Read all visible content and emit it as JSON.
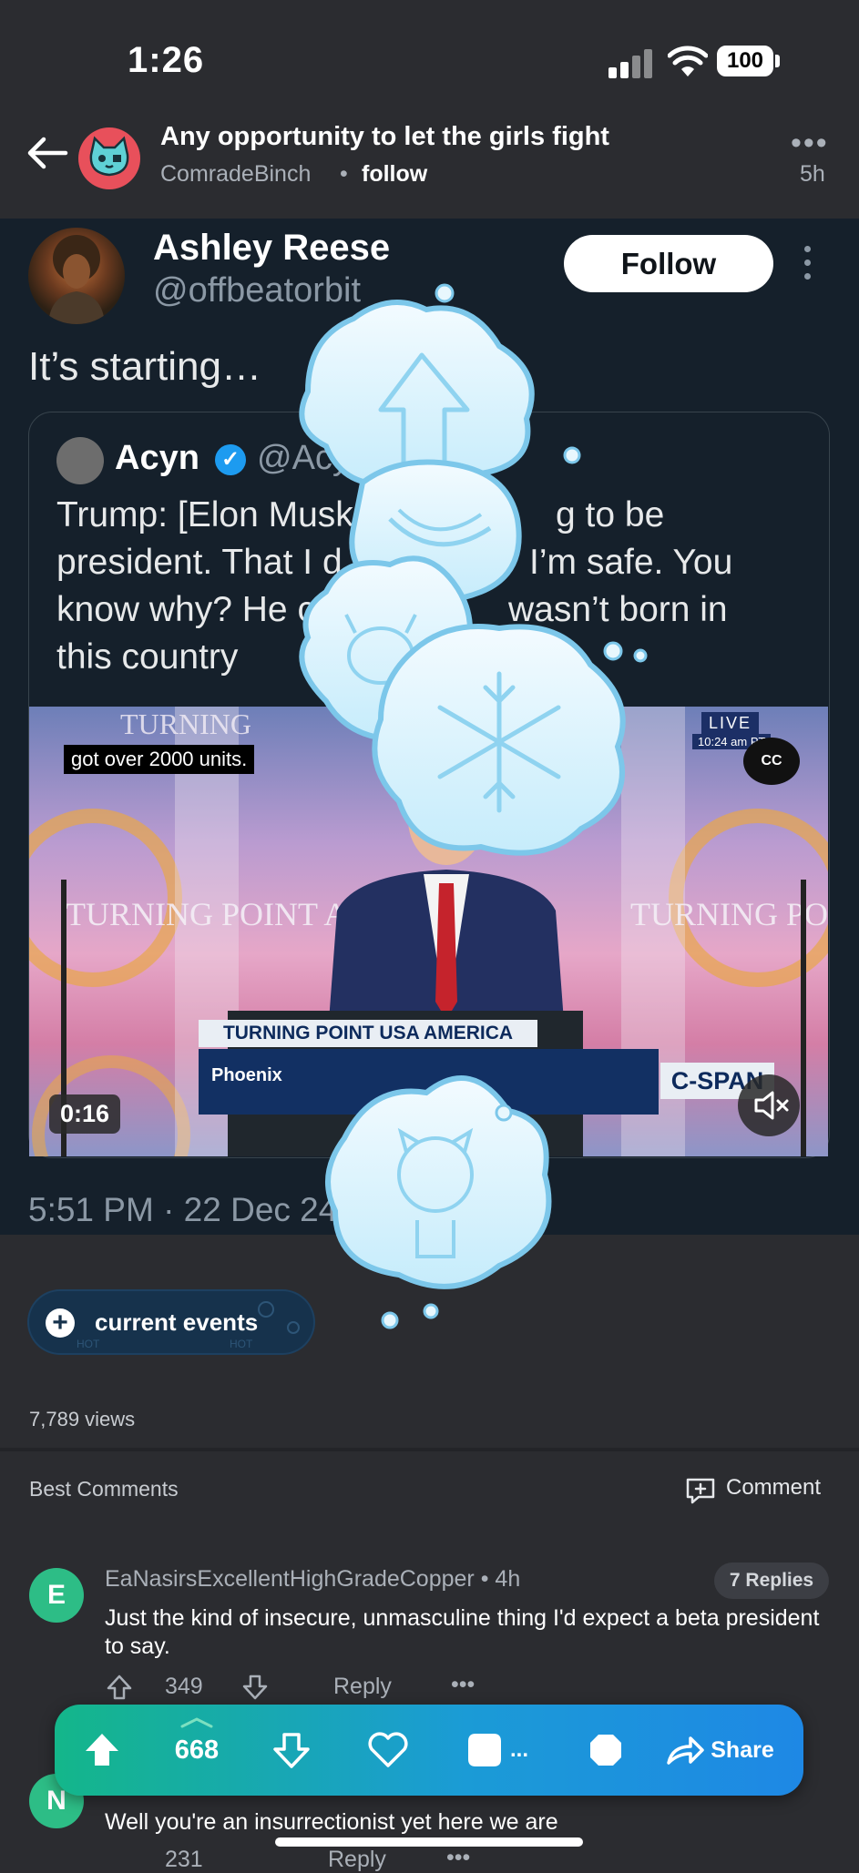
{
  "status_bar": {
    "time": "1:26",
    "battery": "100"
  },
  "post_header": {
    "title": "Any opportunity to let the girls fight",
    "author": "ComradeBinch",
    "separator": "•",
    "follow_label": "follow",
    "more": "•••",
    "age": "5h"
  },
  "tweet": {
    "name": "Ashley Reese",
    "handle": "@offbeatorbit",
    "follow_label": "Follow",
    "text": "It’s starting…",
    "quote": {
      "name": "Acyn",
      "handle": "@Acy",
      "lines": [
        "Trump: [Elon Musk",
        "g to be",
        "president. That I d",
        "I’m safe. You",
        "know why? He ca",
        "wasn’t born in",
        "this country"
      ]
    },
    "video": {
      "caption": "got over 2000 units.",
      "live_badge": "LIVE",
      "live_time": "10:24 am PT",
      "cc": "CC",
      "banner_top": "TURNING POINT USA AMERICA FEST",
      "banner_bottom": "Phoenix",
      "network": "C-SPAN",
      "duration": "0:16",
      "backdrop_text_left": "TURNING POINT ACTION",
      "backdrop_text_right": "TURNING POINT ACTIO",
      "backdrop_text_top": "TURNING"
    },
    "timestamp": "5:51 PM · 22 Dec 24"
  },
  "tag": {
    "label": "current events",
    "pattern_text": "HOT"
  },
  "views": "7,789 views",
  "comments_header": {
    "title": "Best Comments",
    "comment_button": "Comment"
  },
  "comments": [
    {
      "avatar_letter": "E",
      "author": "EaNasirsExcellentHighGradeCopper",
      "sep": "•",
      "age": "4h",
      "replies": "7 Replies",
      "text": "Just the kind of insecure, unmasculine thing I'd expect a beta president to say.",
      "score": "349",
      "reply_label": "Reply",
      "more": "•••"
    },
    {
      "avatar_letter": "N",
      "text": "Well you're an insurrectionist yet here we are",
      "score": "231",
      "reply_label": "Reply",
      "more": "•••"
    }
  ],
  "action_bar": {
    "score": "668",
    "more": "...",
    "share_label": "Share"
  },
  "icons": {
    "back": "back-arrow-icon",
    "upvote": "upvote-icon",
    "downvote": "downvote-icon",
    "favorite": "heart-icon",
    "share": "share-icon",
    "mute": "mute-icon",
    "comment": "comment-plus-icon"
  },
  "colors": {
    "background": "#2b2c30",
    "tweet_bg": "#15202b",
    "accent_green": "#14b68a",
    "accent_blue": "#1e88e5",
    "avatar_green": "#2dbd86",
    "verified": "#1d9bf0"
  }
}
